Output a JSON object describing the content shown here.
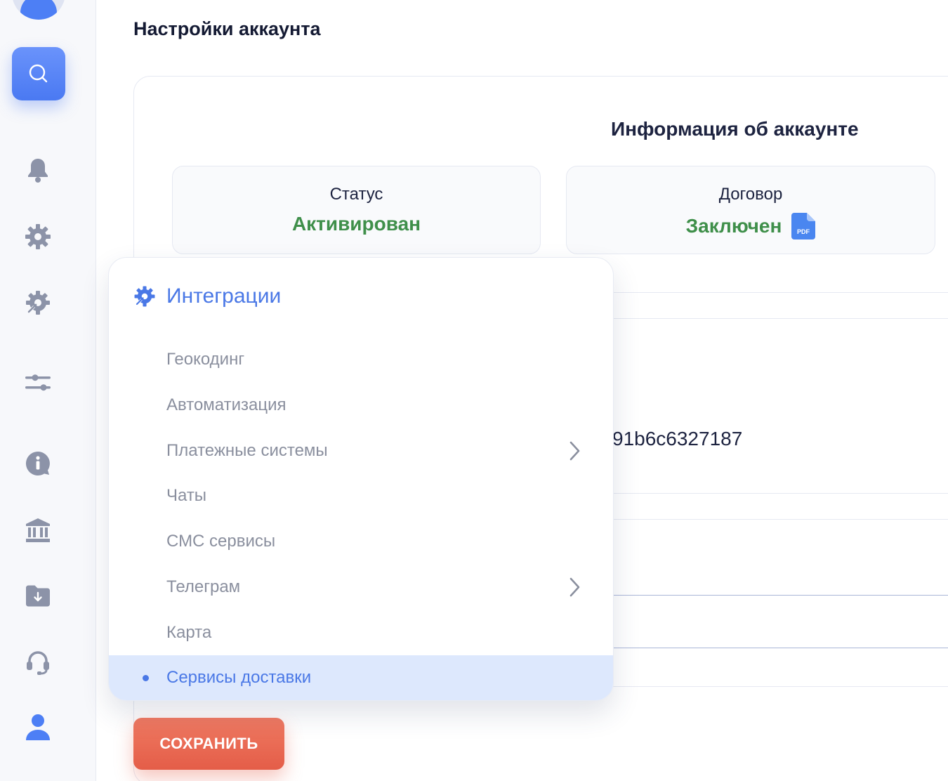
{
  "page": {
    "title": "Настройки аккаунта"
  },
  "account_info": {
    "title": "Информация об аккаунте",
    "status": {
      "label": "Статус",
      "value": "Активирован"
    },
    "contract": {
      "label": "Договор",
      "value": "Заключен",
      "file_icon": "pdf-file-icon",
      "file_badge": "PDF"
    }
  },
  "api_key_fragment": "91b6c6327187",
  "dropdown": {
    "title": "Интеграции",
    "icon": "integrations-gear-icon",
    "items": [
      {
        "label": "Геокодинг",
        "has_submenu": false
      },
      {
        "label": "Автоматизация",
        "has_submenu": false
      },
      {
        "label": "Платежные системы",
        "has_submenu": true
      },
      {
        "label": "Чаты",
        "has_submenu": false
      },
      {
        "label": "СМС сервисы",
        "has_submenu": false
      },
      {
        "label": "Телеграм",
        "has_submenu": true
      },
      {
        "label": "Карта",
        "has_submenu": false
      },
      {
        "label": "Сервисы доставки",
        "has_submenu": false,
        "active": true
      }
    ]
  },
  "actions": {
    "save_label": "СОХРАНИТЬ"
  },
  "sidebar": {
    "icons": [
      "user-avatar",
      "search-icon",
      "bell-icon",
      "gear-icon",
      "integrations-icon",
      "sliders-icon",
      "info-icon",
      "bank-icon",
      "folder-download-icon",
      "headset-icon",
      "user-icon"
    ]
  },
  "colors": {
    "accent": "#4a78e6",
    "success": "#3f8f4a",
    "danger": "#e45d48"
  }
}
